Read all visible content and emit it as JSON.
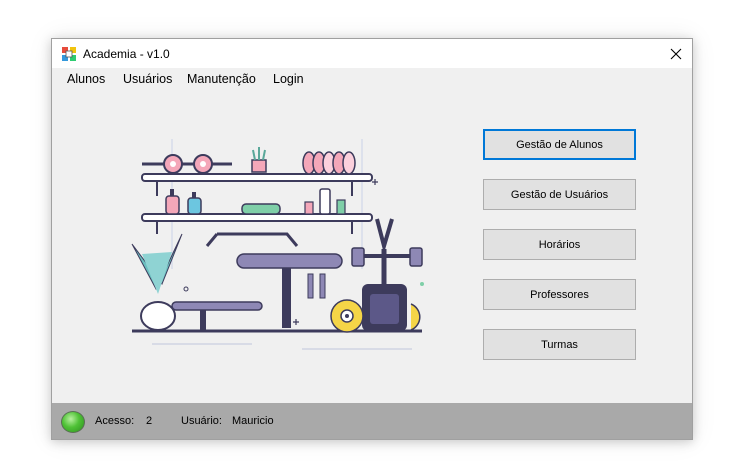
{
  "window": {
    "title": "Academia - v1.0"
  },
  "menu": {
    "items": [
      "Alunos",
      "Usuários",
      "Manutenção",
      "Login"
    ]
  },
  "buttons": {
    "alunos": "Gestão de Alunos",
    "usuarios": "Gestão de Usuários",
    "horarios": "Horários",
    "professores": "Professores",
    "turmas": "Turmas"
  },
  "status": {
    "acesso_label": "Acesso:",
    "acesso_value": "2",
    "usuario_label": "Usuário:",
    "usuario_value": "Mauricio",
    "led_color": "#4fc236"
  },
  "icons": {
    "app": "app-icon",
    "close": "close-icon",
    "illustration": "gym-illustration"
  }
}
